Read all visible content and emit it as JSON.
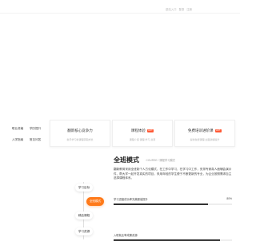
{
  "header": {
    "links": [
      "进站入口",
      "登录",
      "注册"
    ]
  },
  "quick_links": [
    "职业资格",
    "学历提升",
    "入学指南",
    "常见问答"
  ],
  "cards": [
    {
      "title": "翻新核心竞争力",
      "desc": "新手学习新课程获取成长",
      "tag": ""
    },
    {
      "title": "课程体验",
      "desc": "课程介绍 课程 学习 资源",
      "tag": "HOT"
    },
    {
      "title": "免费培训进阶课",
      "desc": "提供免费课程 全面讲解提升",
      "tag": "HOT"
    }
  ],
  "section": {
    "title": "全班模式",
    "subtitle": "COURSE / 课程学习模式",
    "body": "翻新教育采用全班制个人方化模式，在工作中学习，在学习中工作，安排专家真人面辅会演示件，帮大学一起开发真实的项目，采用年轻的学生便于不断更新的专业，为企业按照需求自主选择课程体系。"
  },
  "timeline": [
    "学习目标",
    "全班模式",
    "精品课程",
    "学习资源"
  ],
  "progress": [
    {
      "label": "学习进度成功率完美服装提升",
      "percent": 80,
      "percent_label": "80%"
    },
    {
      "label": "入职就业率成果资源",
      "percent": 90,
      "percent_label": ""
    }
  ],
  "colors": {
    "accent": "#ff7a1a",
    "tag": "#ff5a36",
    "bar": "#333333"
  }
}
